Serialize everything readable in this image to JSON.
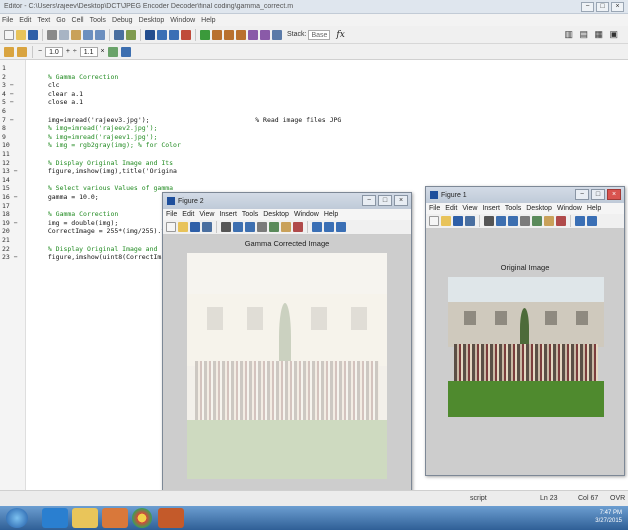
{
  "editor": {
    "title": "Editor - C:\\Users\\rajeev\\Desktop\\DCT\\JPEG Encoder Decoder\\final coding\\gamma_correct.m",
    "menu": [
      "File",
      "Edit",
      "Text",
      "Go",
      "Cell",
      "Tools",
      "Debug",
      "Desktop",
      "Window",
      "Help"
    ],
    "stack_label": "Stack:",
    "stack_value": "Base",
    "fx": "fx",
    "cell_minus": "−",
    "cell_value": "1.0",
    "cell_plus": "+",
    "cell_div": "÷",
    "cell_value2": "1.1",
    "cell_times": "×",
    "window_buttons": [
      "−",
      "□",
      "×"
    ],
    "toolbar_right": "▥ ▤ ▦ ▣"
  },
  "code_lines": [
    {
      "n": "1",
      "text": ""
    },
    {
      "n": "2",
      "text": "  % Gamma Correction",
      "kind": "cm"
    },
    {
      "n": "3 −",
      "text": "  clc"
    },
    {
      "n": "4 −",
      "text": "  clear a.1"
    },
    {
      "n": "5 −",
      "text": "  close a.1"
    },
    {
      "n": "6",
      "text": ""
    },
    {
      "n": "7 −",
      "text": "  img=imread('rajeev3.jpg');                           % Read image files JPG"
    },
    {
      "n": "8",
      "text": "  % img=imread('rajeev2.jpg');",
      "kind": "cm"
    },
    {
      "n": "9",
      "text": "  % img=imread('rajeev1.jpg');",
      "kind": "cm"
    },
    {
      "n": "10",
      "text": "  % img = rgb2gray(img); % for Color",
      "kind": "cm"
    },
    {
      "n": "11",
      "text": ""
    },
    {
      "n": "12",
      "text": "  % Display Original Image and Its",
      "kind": "cm"
    },
    {
      "n": "13 −",
      "text": "  figure,imshow(img),title('Origina"
    },
    {
      "n": "14",
      "text": ""
    },
    {
      "n": "15",
      "text": "  % Select various Values of gamma",
      "kind": "cm"
    },
    {
      "n": "16 −",
      "text": "  gamma = 10.0;"
    },
    {
      "n": "17",
      "text": ""
    },
    {
      "n": "18",
      "text": "  % Gamma Correction",
      "kind": "cm"
    },
    {
      "n": "19 −",
      "text": "  img = double(img);"
    },
    {
      "n": "20",
      "text": "  CorrectImage = 255*(img/255).^(1/"
    },
    {
      "n": "21",
      "text": ""
    },
    {
      "n": "22",
      "text": "  % Display Original Image and Its",
      "kind": "cm"
    },
    {
      "n": "23 −",
      "text": "  figure,imshow(uint8(CorrectImage"
    }
  ],
  "figure2": {
    "title": "Figure 2",
    "menu": [
      "File",
      "Edit",
      "View",
      "Insert",
      "Tools",
      "Desktop",
      "Window",
      "Help"
    ],
    "axes_title": "Gamma Corrected Image",
    "buttons": [
      "−",
      "□",
      "×"
    ]
  },
  "figure1": {
    "title": "Figure 1",
    "menu": [
      "File",
      "Edit",
      "View",
      "Insert",
      "Tools",
      "Desktop",
      "Window",
      "Help"
    ],
    "axes_title": "Original Image",
    "buttons": [
      "−",
      "□",
      "×"
    ]
  },
  "status": {
    "mode": "script",
    "ln": "Ln 23",
    "col": "Col 67",
    "ovr": "OVR"
  },
  "taskbar": {
    "time": "7:47 PM",
    "date": "3/27/2015"
  }
}
